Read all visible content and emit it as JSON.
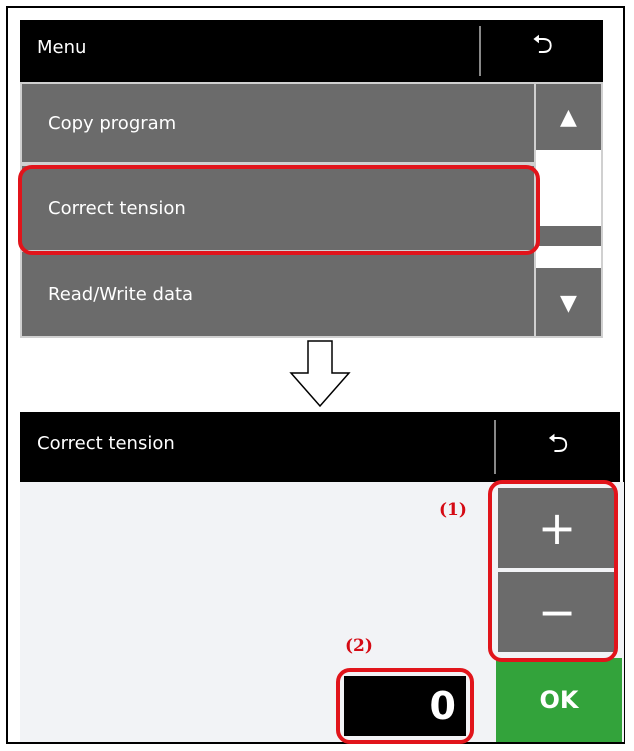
{
  "menu_screen": {
    "title": "Menu",
    "back_icon": "⮌",
    "items": [
      {
        "label": "Copy program"
      },
      {
        "label": "Correct tension"
      },
      {
        "label": "Read/Write data"
      }
    ],
    "scroll_up_icon": "▲",
    "scroll_down_icon": "▼"
  },
  "tension_screen": {
    "title": "Correct tension",
    "back_icon": "⮌",
    "plus_label": "+",
    "minus_label": "−",
    "value": "0",
    "ok_label": "OK"
  },
  "annotations": {
    "label_1": "(1)",
    "label_2": "(2)"
  },
  "colors": {
    "highlight": "#e1141b",
    "ok_button": "#33a33b",
    "button_gray": "#6b6b6b",
    "header": "#000000",
    "annotation_text": "#d50a14"
  }
}
